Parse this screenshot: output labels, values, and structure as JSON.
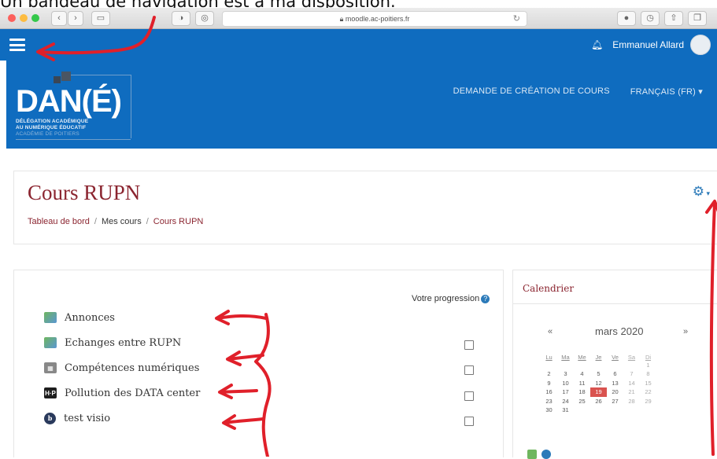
{
  "caption": "Un bandeau de navigation est à ma disposition.",
  "browser": {
    "url": "moodle.ac-poitiers.fr"
  },
  "navbar": {
    "user_name": "Emmanuel Allard"
  },
  "logo": {
    "text": "DAN(É)",
    "line1": "DÉLÉGATION ACADÉMIQUE",
    "line2": "AU NUMÉRIQUE ÉDUCATIF",
    "line3": "ACADÉMIE DE POITIERS"
  },
  "topnav": {
    "course_request": "DEMANDE DE CRÉATION DE COURS",
    "language": "FRANÇAIS (FR)"
  },
  "course": {
    "title": "Cours RUPN",
    "breadcrumb": [
      "Tableau de bord",
      "Mes cours",
      "Cours RUPN"
    ]
  },
  "main": {
    "progress_label": "Votre progression",
    "activities": [
      {
        "name": "Annonces",
        "icon": "forum-icon",
        "has_checkbox": false
      },
      {
        "name": "Echanges entre RUPN",
        "icon": "forum-icon",
        "has_checkbox": true
      },
      {
        "name": "Compétences numériques",
        "icon": "competency-icon",
        "has_checkbox": true
      },
      {
        "name": "Pollution des DATA center",
        "icon": "h5p-icon",
        "has_checkbox": true
      },
      {
        "name": "test visio",
        "icon": "visio-icon",
        "has_checkbox": true
      }
    ]
  },
  "calendar": {
    "title": "Calendrier",
    "prev": "«",
    "month": "mars 2020",
    "next": "»",
    "weekdays": [
      "Lu",
      "Ma",
      "Me",
      "Je",
      "Ve",
      "Sa",
      "Di"
    ],
    "weeks": [
      [
        "",
        "",
        "",
        "",
        "",
        "",
        "1"
      ],
      [
        "2",
        "3",
        "4",
        "5",
        "6",
        "7",
        "8"
      ],
      [
        "9",
        "10",
        "11",
        "12",
        "13",
        "14",
        "15"
      ],
      [
        "16",
        "17",
        "18",
        "19",
        "20",
        "21",
        "22"
      ],
      [
        "23",
        "24",
        "25",
        "26",
        "27",
        "28",
        "29"
      ],
      [
        "30",
        "31",
        "",
        "",
        "",
        "",
        ""
      ]
    ],
    "today": "19"
  },
  "colors": {
    "navbar": "#0f6cbf",
    "course_title": "#8b2530",
    "annotation": "#e0202a"
  }
}
